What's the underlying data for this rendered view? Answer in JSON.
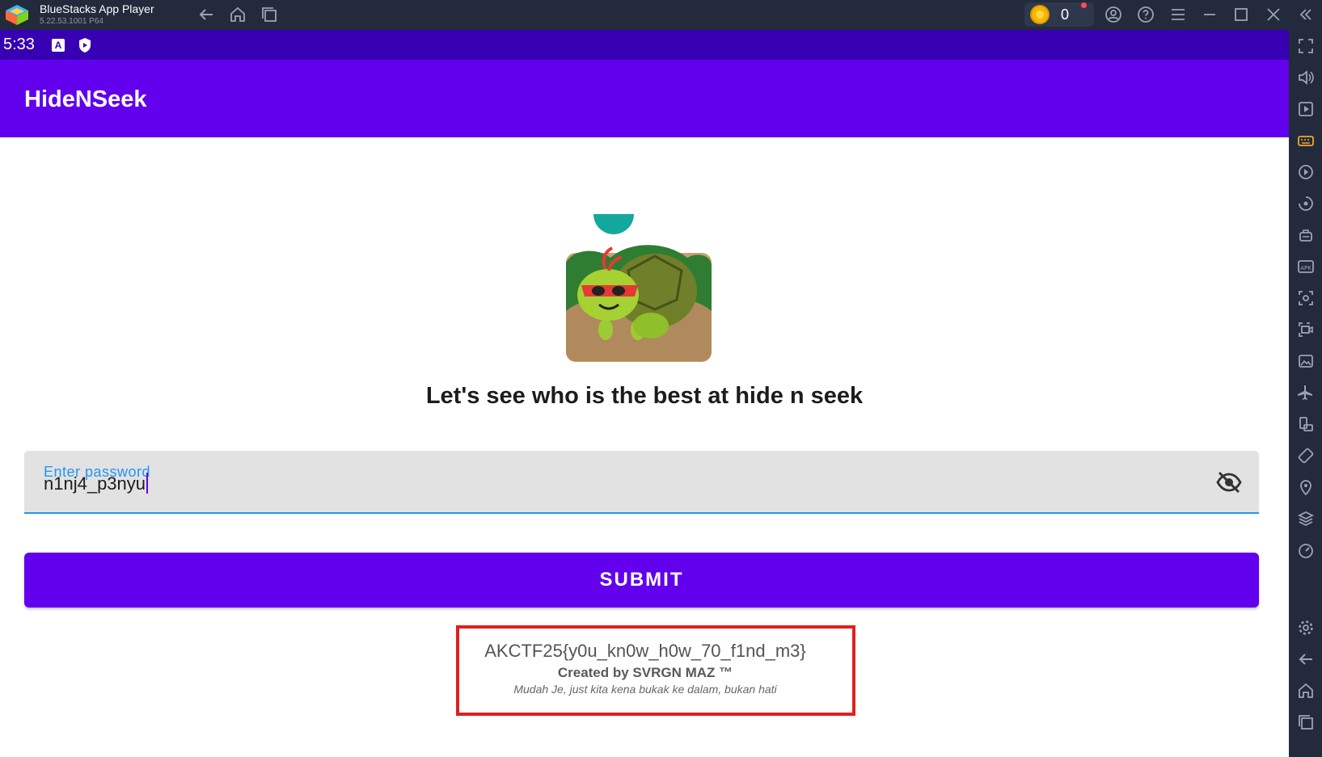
{
  "window": {
    "title": "BlueStacks App Player",
    "version": "5.22.53.1001 P64",
    "coin_count": "0"
  },
  "status_bar": {
    "time": "5:33",
    "notification_icons": [
      "a-letter-icon",
      "shield-icon"
    ]
  },
  "app": {
    "title": "HideNSeek",
    "headline": "Let's see who is the best at hide n seek",
    "password_field": {
      "label": "Enter password",
      "value": "n1nj4_p3nyu"
    },
    "submit_label": "SUBMIT",
    "result": {
      "flag": "AKCTF25{y0u_kn0w_h0w_70_f1nd_m3}",
      "credit": "Created by SVRGN MAZ ™",
      "tagline": "Mudah Je, just kita kena bukak ke dalam, bukan hati"
    }
  },
  "titlebar_icons": [
    "back-arrow-icon",
    "home-icon",
    "multi-instance-icon",
    "coin-icon",
    "account-icon",
    "help-icon",
    "menu-icon",
    "minimize-icon",
    "maximize-icon",
    "close-icon",
    "collapse-sidebar-icon"
  ],
  "sidebar_icons": [
    "fullscreen-icon",
    "volume-icon",
    "media-manager-icon",
    "keyboard-icon",
    "macro-record-icon",
    "macro-playback-icon",
    "multi-instance-manager-icon",
    "install-apk-icon",
    "screenshot-icon",
    "screen-record-icon",
    "gallery-icon",
    "airplane-mode-icon",
    "rotate-icon",
    "shake-icon",
    "location-icon",
    "layers-icon",
    "performance-icon",
    "settings-icon",
    "back-icon",
    "home-icon",
    "recent-apps-icon"
  ],
  "colors": {
    "app_bar": "#6200ee",
    "status_bar": "#3700b3",
    "accent_blue": "#2196f3",
    "highlight_red": "#e0201e",
    "bluestacks_chrome": "#222a3b"
  }
}
